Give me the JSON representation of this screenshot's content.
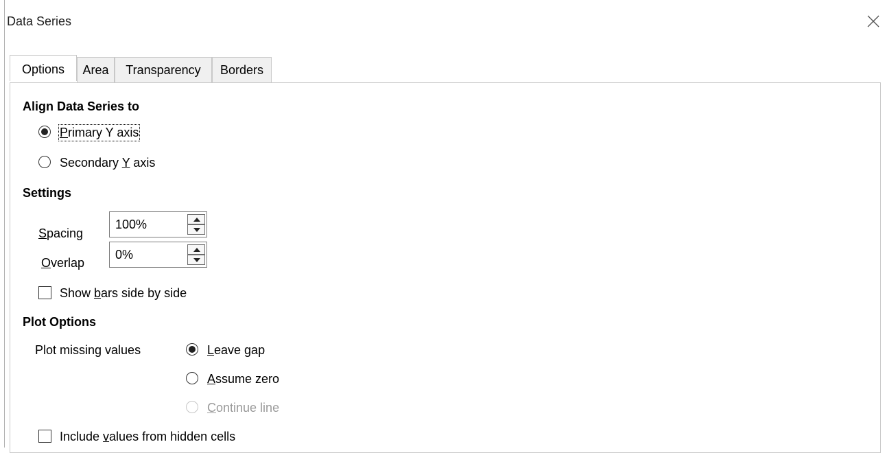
{
  "window": {
    "title": "Data Series"
  },
  "tabs": [
    {
      "label": "Options",
      "active": true
    },
    {
      "label": "Area",
      "active": false
    },
    {
      "label": "Transparency",
      "active": false
    },
    {
      "label": "Borders",
      "active": false
    }
  ],
  "align": {
    "heading": "Align Data Series to",
    "primary": {
      "pre": "",
      "mn": "P",
      "post": "rimary Y axis",
      "checked": true
    },
    "secondary": {
      "pre": "Secondary ",
      "mn": "Y",
      "post": " axis",
      "checked": false
    }
  },
  "settings": {
    "heading": "Settings",
    "spacing": {
      "mn": "S",
      "post": "pacing",
      "value": "100%"
    },
    "overlap": {
      "mn": "O",
      "post": "verlap",
      "value": "0%"
    },
    "side_by_side": {
      "pre": "Show ",
      "mn": "b",
      "post": "ars side by side",
      "checked": false
    }
  },
  "plot": {
    "heading": "Plot Options",
    "missing_label": "Plot missing values",
    "leave_gap": {
      "mn": "L",
      "post": "eave gap",
      "checked": true
    },
    "assume_zero": {
      "mn": "A",
      "post": "ssume zero",
      "checked": false
    },
    "continue_line": {
      "mn": "C",
      "post": "ontinue line",
      "checked": false,
      "disabled": true
    },
    "hidden_cells": {
      "pre": "Include ",
      "mn": "v",
      "post": "alues from hidden cells",
      "checked": false
    }
  },
  "colors": {
    "border": "#c8c8c8",
    "disabled_text": "#9a9a9a",
    "title_text": "#202020"
  },
  "icons": {
    "close": "close-icon",
    "spin_up": "spin-up-icon",
    "spin_down": "spin-down-icon"
  }
}
